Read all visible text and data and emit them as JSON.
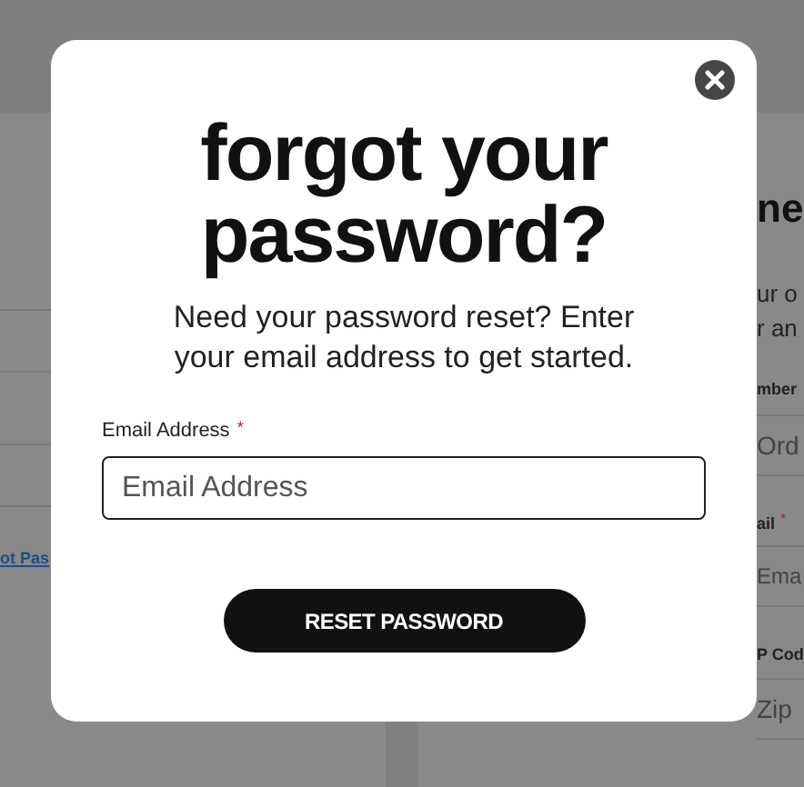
{
  "page": {
    "heading": "ne",
    "intro_lines": [
      "ur o",
      "r an"
    ],
    "fields": [
      {
        "label": "mber",
        "placeholder": "Ord"
      },
      {
        "label": "ail",
        "required_mark": "*",
        "placeholder": "Ema"
      },
      {
        "label": "P Cod",
        "placeholder": "Zip"
      }
    ],
    "link": "ot Pas"
  },
  "modal": {
    "title": "forgot your password?",
    "text": "Need your password reset? Enter your email address to get started.",
    "field": {
      "label": "Email Address",
      "required_mark": "*",
      "placeholder": "Email Address"
    },
    "button": "RESET PASSWORD"
  }
}
